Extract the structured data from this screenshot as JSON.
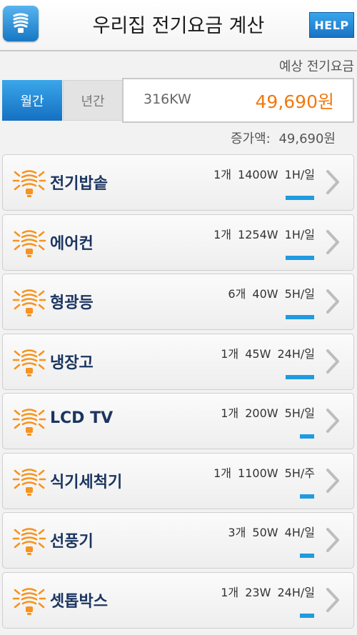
{
  "header": {
    "title": "우리집 전기요금 계산",
    "help_label": "HELP",
    "app_icon": "lightbulb-icon"
  },
  "estimate": {
    "label": "예상 전기요금",
    "tabs": {
      "monthly": "월간",
      "yearly": "년간",
      "selected": "monthly"
    },
    "kw": "316KW",
    "amount": "49,690원",
    "increase": "증가액:  49,690원"
  },
  "colors": {
    "accent": "#1f9be0",
    "amount": "#f07a10",
    "bulb": "#f7931e",
    "name": "#1c3560"
  },
  "appliances": [
    {
      "name": "전기밥솥",
      "specs": "1개  1400W  1H/일",
      "usage_level": 0.5,
      "icon": "lightbulb-icon"
    },
    {
      "name": "에어컨",
      "specs": "1개  1254W  1H/일",
      "usage_level": 0.5,
      "icon": "lightbulb-icon"
    },
    {
      "name": "형광등",
      "specs": "6개  40W  5H/일",
      "usage_level": 0.5,
      "icon": "lightbulb-icon"
    },
    {
      "name": "냉장고",
      "specs": "1개  45W  24H/일",
      "usage_level": 0.5,
      "icon": "lightbulb-icon"
    },
    {
      "name": "LCD TV",
      "specs": "1개  200W  5H/일",
      "usage_level": 0.25,
      "icon": "lightbulb-icon"
    },
    {
      "name": "식기세척기",
      "specs": "1개  1100W  5H/주",
      "usage_level": 0.25,
      "icon": "lightbulb-icon"
    },
    {
      "name": "선풍기",
      "specs": "3개  50W  4H/일",
      "usage_level": 0.25,
      "icon": "lightbulb-icon"
    },
    {
      "name": "셋톱박스",
      "specs": "1개  23W  24H/일",
      "usage_level": 0.25,
      "icon": "lightbulb-icon"
    }
  ]
}
